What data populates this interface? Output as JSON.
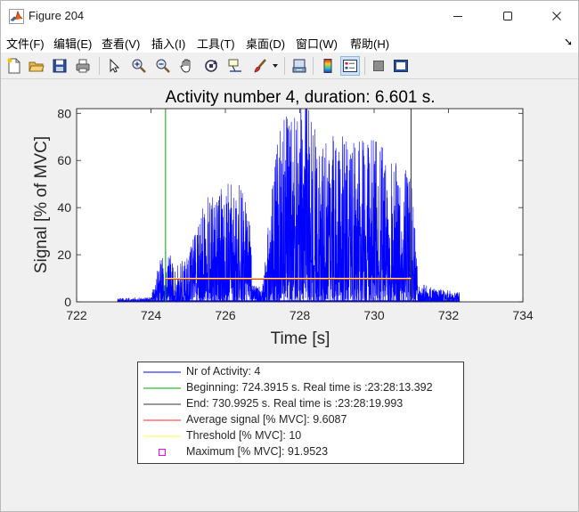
{
  "window": {
    "title": "Figure 204",
    "controls": [
      "minimize",
      "maximize",
      "close"
    ]
  },
  "menu": {
    "items": [
      "文件(F)",
      "编辑(E)",
      "查看(V)",
      "插入(I)",
      "工具(T)",
      "桌面(D)",
      "窗口(W)",
      "帮助(H)"
    ],
    "overflow_glyph": "➘"
  },
  "toolbar": {
    "buttons": [
      "new-figure-icon",
      "open-file-icon",
      "save-icon",
      "print-icon",
      "pointer-icon",
      "zoom-in-icon",
      "zoom-out-icon",
      "pan-hand-icon",
      "rotate-3d-icon",
      "data-cursor-icon",
      "brush-icon",
      "brush-dropdown-icon",
      "link-plot-icon",
      "colorbar-icon",
      "legend-icon",
      "hide-plot-tools-icon",
      "show-plot-tools-icon"
    ],
    "pressed": "legend-icon"
  },
  "chart_data": {
    "type": "line",
    "title": "Activity number 4, duration: 6.601 s.",
    "xlabel": "Time [s]",
    "ylabel": "Signal [% of MVC]",
    "xlim": [
      722,
      734
    ],
    "ylim": [
      0,
      82
    ],
    "xticks": [
      "722",
      "724",
      "726",
      "728",
      "730",
      "732",
      "734"
    ],
    "yticks": [
      "0",
      "20",
      "40",
      "60",
      "80"
    ],
    "grid": false,
    "series": [
      {
        "name": "Nr of Activity: 4",
        "color": "#0000ff",
        "kind": "emg-signal",
        "x_range": [
          723.1,
          732.3
        ],
        "envelope": {
          "x": [
            723.1,
            724.0,
            724.39,
            724.6,
            725.0,
            725.5,
            726.0,
            726.4,
            726.8,
            727.0,
            727.4,
            727.8,
            728.2,
            728.6,
            729.0,
            729.5,
            730.0,
            730.5,
            730.99,
            731.2,
            731.6,
            732.0,
            732.3
          ],
          "y": [
            1.5,
            2,
            28,
            15,
            20,
            45,
            50,
            55,
            28,
            7,
            75,
            82,
            92,
            70,
            72,
            68,
            70,
            62,
            55,
            8,
            6,
            5,
            4
          ]
        }
      },
      {
        "name": "Beginning: 724.3915 s. Real time is :23:28:13.392",
        "color": "#00aa00",
        "x": 724.3915
      },
      {
        "name": "End: 730.9925 s. Real time is :23:28:19.993",
        "color": "#333333",
        "x": 730.9925
      },
      {
        "name": "Average signal [% MVC]: 9.6087",
        "color": "#ff2a2a",
        "y": 9.6087
      },
      {
        "name": "Threshold [% MVC]: 10",
        "color": "#ffff80",
        "y": 10
      },
      {
        "name": "Maximum [% MVC]: 91.9523",
        "color": "#ff00ff",
        "y": 91.9523
      }
    ],
    "legend_position": "below-axes"
  }
}
